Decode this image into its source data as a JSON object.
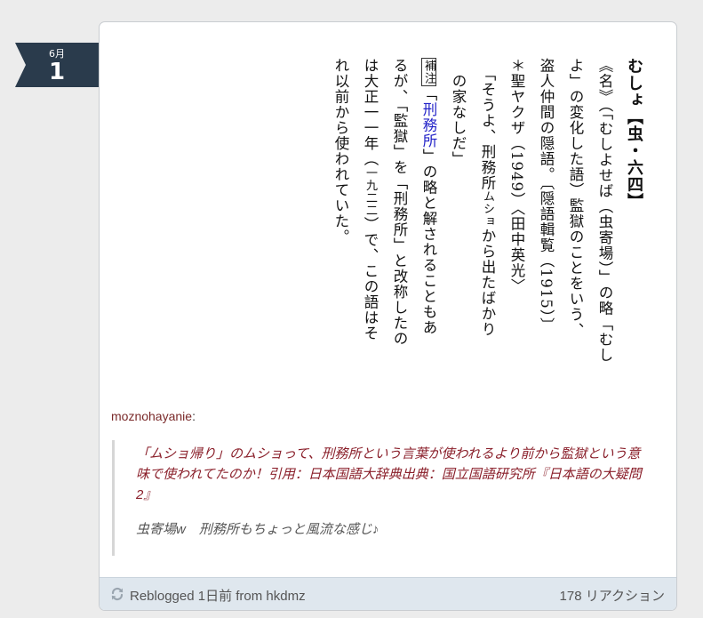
{
  "date": {
    "month": "6月",
    "day": "1"
  },
  "dictionary": {
    "lines": [
      {
        "headword": "むしょ",
        "bracket": "【虫・六四】"
      },
      {
        "text": "《名》（「むしよせば（虫寄場）」の略「むし"
      },
      {
        "text": "よ」の変化した語）監獄のことをいう、"
      },
      {
        "text": "盗人仲間の隠語。〔隠語輯覧（1915）〕"
      },
      {
        "text": "＊聖ヤクザ（1949）〈田中英光〉"
      },
      {
        "text": "　「そうよ、刑務所",
        "ruby": "ムショ",
        "text2": "から出たばかり"
      },
      {
        "text": "　の家なしだ」"
      },
      {
        "box": "補注",
        "pre": "「",
        "link": "刑務所",
        "text": "」の略と解されることもあ"
      },
      {
        "text": "るが、「監獄」を「刑務所」と改称したの"
      },
      {
        "text": "は大正一一年（",
        "small": "一九二二",
        "text2": "）で、この語はそ"
      },
      {
        "text": "れ以前から使われていた。"
      }
    ]
  },
  "post": {
    "poster": "moznohayanie",
    "colon": ":",
    "quote_body": "「ムショ帰り」のムショって、刑務所という言葉が使われるより前から監獄という意味で使われてたのか！引用：日本国語大辞典出典：国立国語研究所『日本語の大疑問2』",
    "quote_tail": "虫寄場w　刑務所もちょっと風流な感じ♪"
  },
  "footer": {
    "reblogged_label": "Reblogged 1日前 from",
    "source": "hkdmz",
    "reactions": "178 リアクション"
  },
  "colors": {
    "date_tag": "#2a3b4c",
    "quote_text": "#8a1f2a",
    "poster": "#7a2a2a",
    "footer_bg": "#dfe7ee",
    "link_blue": "#2323c8"
  }
}
